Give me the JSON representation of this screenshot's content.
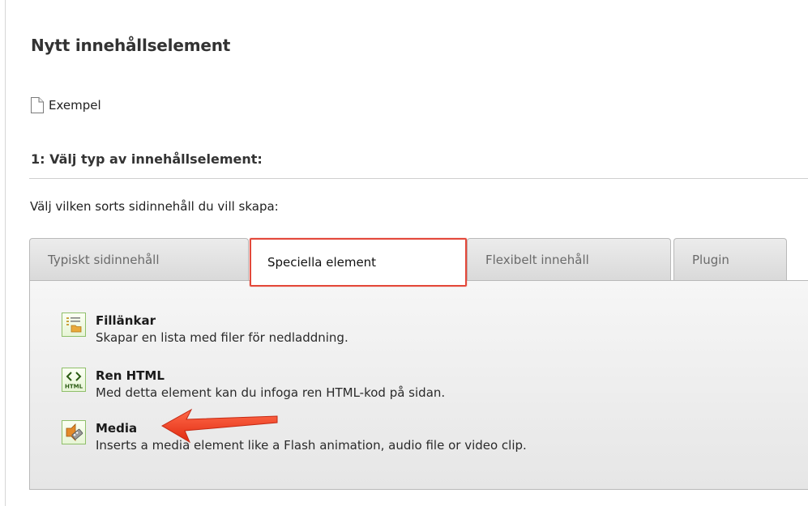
{
  "header": {
    "title": "Nytt innehållselement"
  },
  "page": {
    "name": "Exempel",
    "icon": "page-document-icon"
  },
  "step": {
    "heading": "1: Välj typ av innehållselement:",
    "instruction": "Välj vilken sorts sidinnehåll du vill skapa:"
  },
  "tabs": [
    {
      "label": "Typiskt sidinnehåll",
      "active": false
    },
    {
      "label": "Speciella element",
      "active": true
    },
    {
      "label": "Flexibelt innehåll",
      "active": false
    },
    {
      "label": "Plugin",
      "active": false
    }
  ],
  "elements": [
    {
      "title": "Fillänkar",
      "description": "Skapar en lista med filer för nedladdning.",
      "icon": "file-links-icon"
    },
    {
      "title": "Ren HTML",
      "description": "Med detta element kan du infoga ren HTML-kod på sidan.",
      "icon": "html-code-icon"
    },
    {
      "title": "Media",
      "description": "Inserts a media element like a Flash animation, audio file or video clip.",
      "icon": "media-icon"
    }
  ],
  "colors": {
    "highlight": "#e3483a",
    "icon_border": "#8fbf6a",
    "panel_bg": "#eeeeee"
  }
}
